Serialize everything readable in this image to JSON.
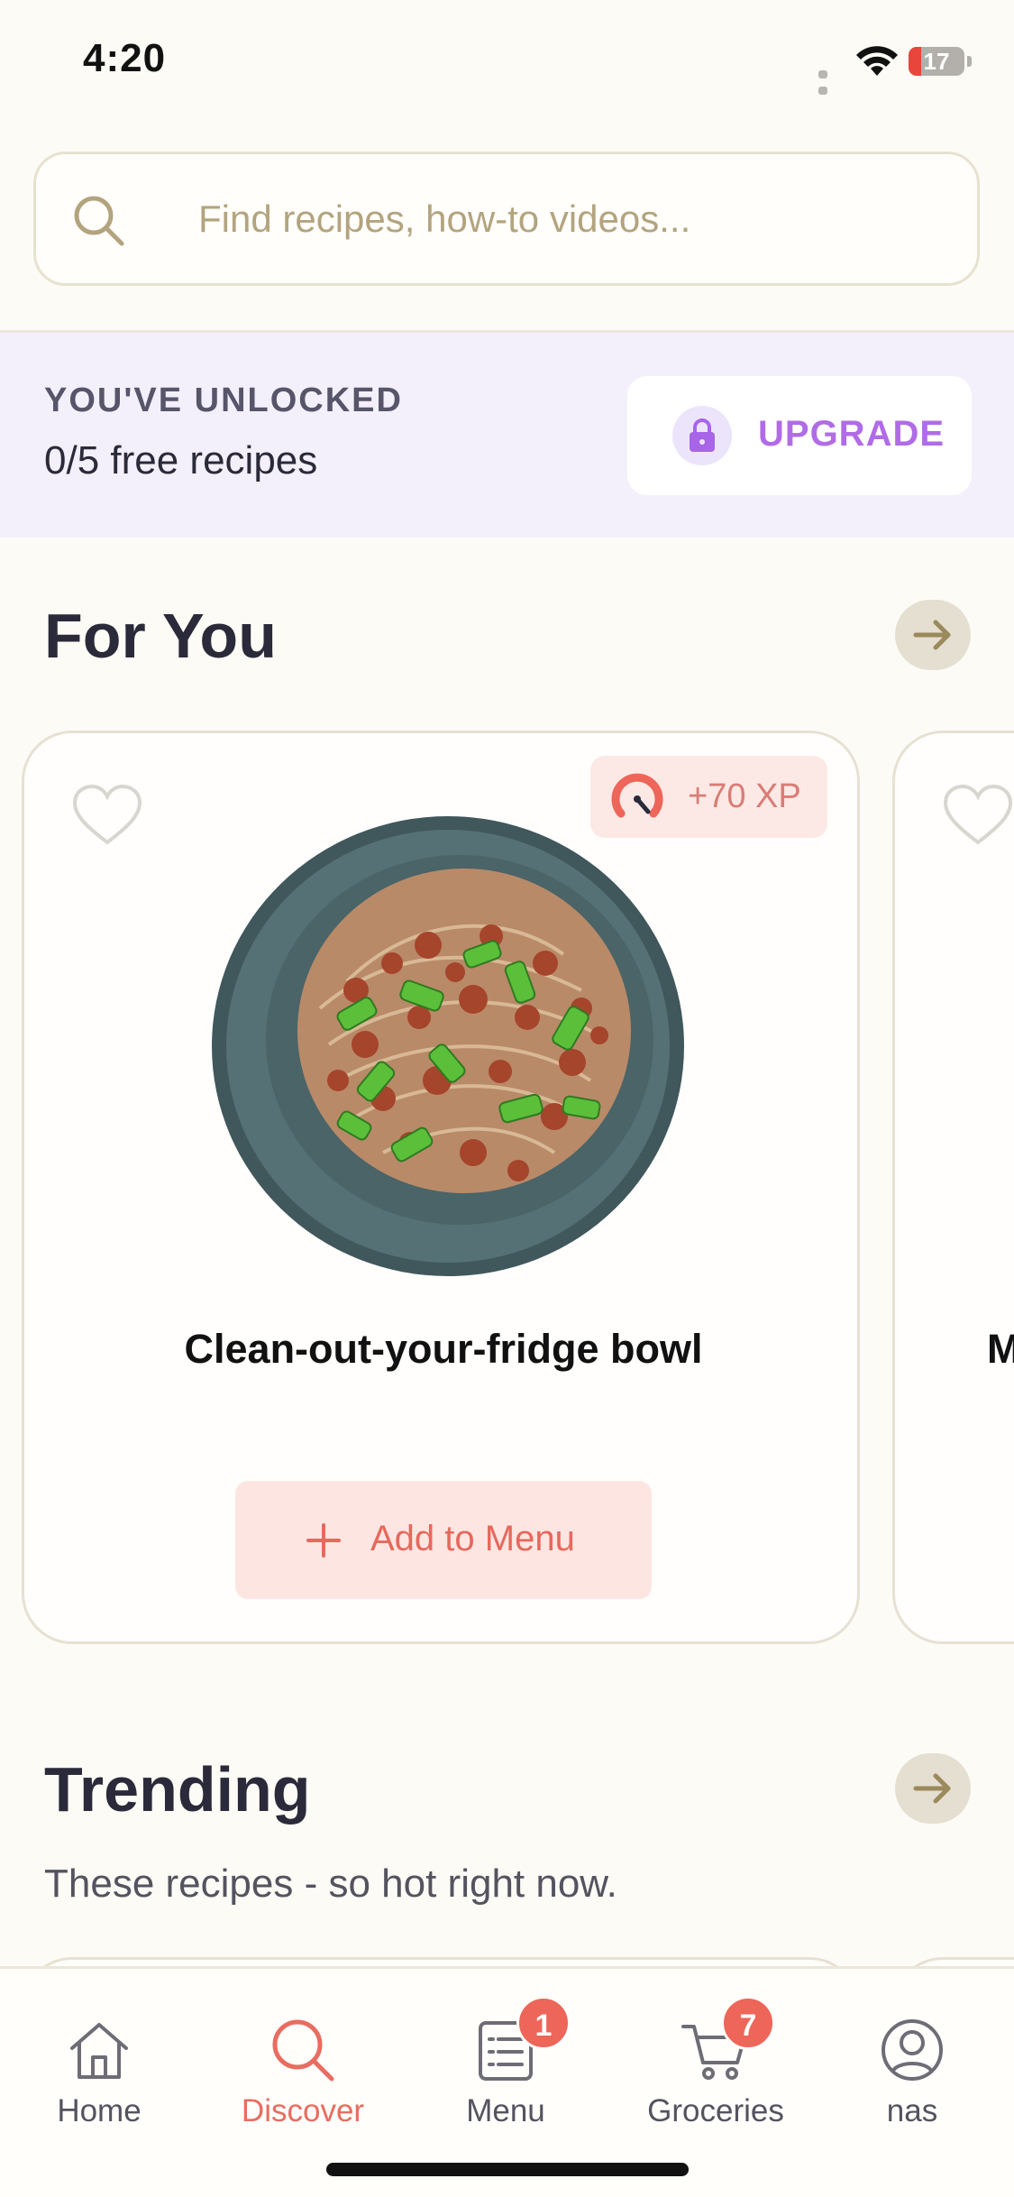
{
  "status_bar": {
    "time": "4:20",
    "battery": "17"
  },
  "search": {
    "placeholder": "Find recipes, how-to videos..."
  },
  "unlock_banner": {
    "kicker": "YOU'VE UNLOCKED",
    "count": "0/5 free recipes",
    "upgrade_label": "UPGRADE"
  },
  "for_you": {
    "title": "For You",
    "cards": [
      {
        "title": "Clean-out-your-fridge bowl",
        "xp": "+70 XP",
        "add_label": "Add to Menu"
      },
      {
        "title": "M"
      }
    ]
  },
  "trending": {
    "title": "Trending",
    "subtitle": "These recipes - so hot right now."
  },
  "tab_bar": {
    "items": [
      {
        "label": "Home"
      },
      {
        "label": "Discover"
      },
      {
        "label": "Menu",
        "badge": "1"
      },
      {
        "label": "Groceries",
        "badge": "7"
      },
      {
        "label": "nas"
      }
    ]
  },
  "colors": {
    "accent": "#e86d60",
    "upgrade": "#b06ce6",
    "background": "#fdfbf6",
    "badge": "#ee6559"
  }
}
